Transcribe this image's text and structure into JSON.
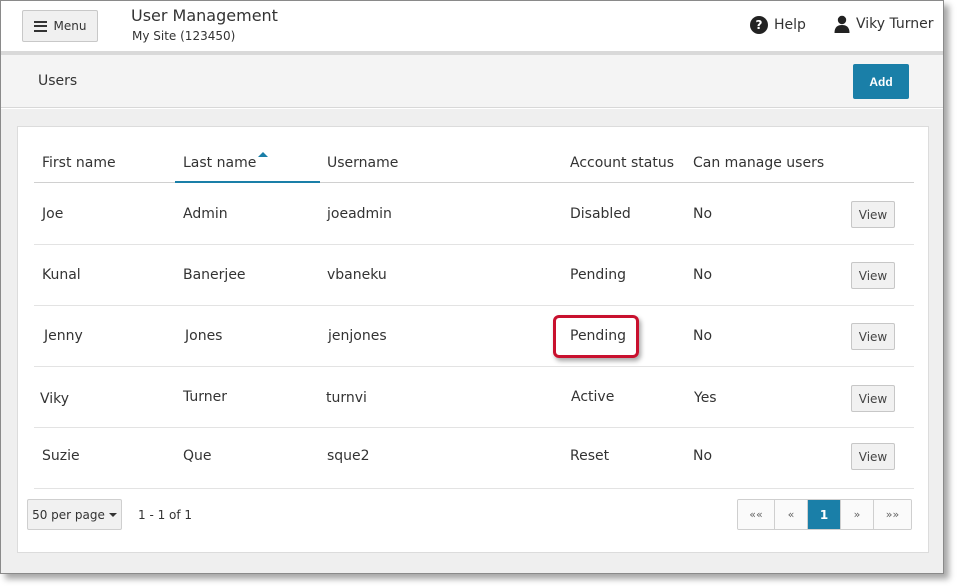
{
  "header": {
    "menu_label": "Menu",
    "app_title": "User Management",
    "site": "My Site (123450)",
    "help_label": "Help",
    "user_name": "Viky Turner"
  },
  "page": {
    "title": "Users",
    "add_label": "Add"
  },
  "table": {
    "columns": [
      "First name",
      "Last name",
      "Username",
      "Account status",
      "Can manage users"
    ],
    "sorted_column": "Last name",
    "sort_direction": "ascending",
    "view_label": "View",
    "rows": [
      {
        "first": "Joe",
        "last": "Admin",
        "username": "joeadmin",
        "status": "Disabled",
        "can_manage": "No"
      },
      {
        "first": "Kunal",
        "last": "Banerjee",
        "username": "vbaneku",
        "status": "Pending",
        "can_manage": "No"
      },
      {
        "first": "Jenny",
        "last": "Jones",
        "username": "jenjones",
        "status": "Pending",
        "can_manage": "No"
      },
      {
        "first": "Viky",
        "last": "Turner",
        "username": "turnvi",
        "status": "Active",
        "can_manage": "Yes"
      },
      {
        "first": "Suzie",
        "last": "Que",
        "username": "sque2",
        "status": "Reset",
        "can_manage": "No"
      }
    ]
  },
  "footer": {
    "per_page": "50 per page",
    "range": "1 - 1 of 1",
    "pager": [
      "««",
      "«",
      "1",
      "»",
      "»»"
    ],
    "current_page": "1"
  },
  "colors": {
    "accent": "#1a7fa8",
    "highlight": "#c8102e"
  }
}
